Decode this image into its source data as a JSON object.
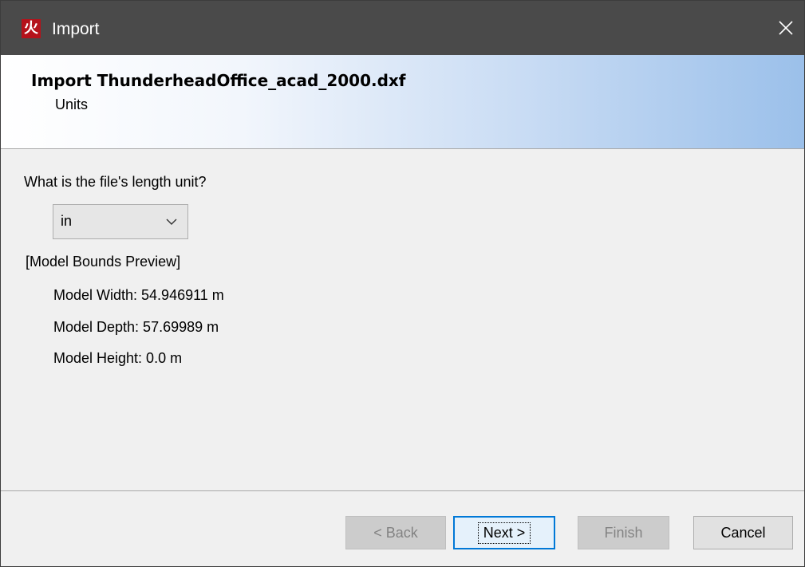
{
  "window": {
    "title": "Import",
    "app_icon_glyph": "火",
    "close_icon": "close-icon"
  },
  "banner": {
    "title": "Import ThunderheadOffice_acad_2000.dxf",
    "subtitle": "Units"
  },
  "units": {
    "question": "What is the file's length unit?",
    "selected_unit": "in",
    "dropdown_icon": "chevron-down-icon"
  },
  "preview": {
    "heading": "[Model Bounds Preview]",
    "width_line": "Model Width:  54.946911 m",
    "depth_line": "Model Depth:  57.69989 m",
    "height_line": "Model Height: 0.0 m"
  },
  "buttons": {
    "back": "< Back",
    "next": "Next >",
    "finish": "Finish",
    "cancel": "Cancel"
  },
  "colors": {
    "titlebar": "#4a4a4a",
    "app_icon": "#b5121b",
    "banner_gradient_end": "#9bc0ea",
    "default_button_border": "#0078d7"
  }
}
